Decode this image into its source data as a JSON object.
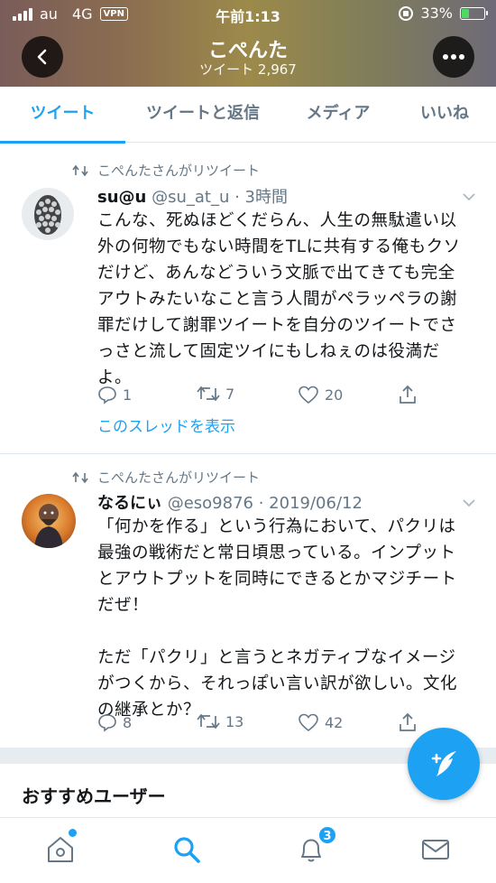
{
  "status_bar": {
    "carrier": "au",
    "network": "4G",
    "vpn": "VPN",
    "time": "午前1:13",
    "battery": "33%"
  },
  "header": {
    "title": "こぺんた",
    "subtitle": "ツイート 2,967"
  },
  "tabs": [
    {
      "label": "ツイート",
      "active": true
    },
    {
      "label": "ツイートと返信",
      "active": false
    },
    {
      "label": "メディア",
      "active": false
    },
    {
      "label": "いいね",
      "active": false
    }
  ],
  "tweets": [
    {
      "retweet_label": "こぺんたさんがリツイート",
      "name": "su@u",
      "meta": " @su_at_u · 3時間",
      "text": "こんな、死ぬほどくだらん、人生の無駄遣い以外の何物でもない時間をTLに共有する俺もクソだけど、あんなどういう文脈で出てきても完全アウトみたいなこと言う人間がペラッペラの謝罪だけして謝罪ツイートを自分のツイートでさっさと流して固定ツイにもしねぇのは役満だよ。",
      "replies": "1",
      "retweets": "7",
      "likes": "20",
      "thread_link": "このスレッドを表示"
    },
    {
      "retweet_label": "こぺんたさんがリツイート",
      "name": "なるにぃ",
      "meta": " @eso9876 · 2019/06/12",
      "text": "「何かを作る」という行為において、パクリは最強の戦術だと常日頃思っている。インプットとアウトプットを同時にできるとかマジチートだぜ！\n\nただ「パクリ」と言うとネガティブなイメージがつくから、それっぽい言い訳が欲しい。文化の継承とか？",
      "replies": "8",
      "retweets": "13",
      "likes": "42"
    }
  ],
  "recommendations": {
    "title": "おすすめユーザー"
  },
  "bottom_nav": {
    "notification_count": "3"
  },
  "colors": {
    "accent": "#1da1f2",
    "muted": "#657786",
    "text": "#14171a"
  }
}
